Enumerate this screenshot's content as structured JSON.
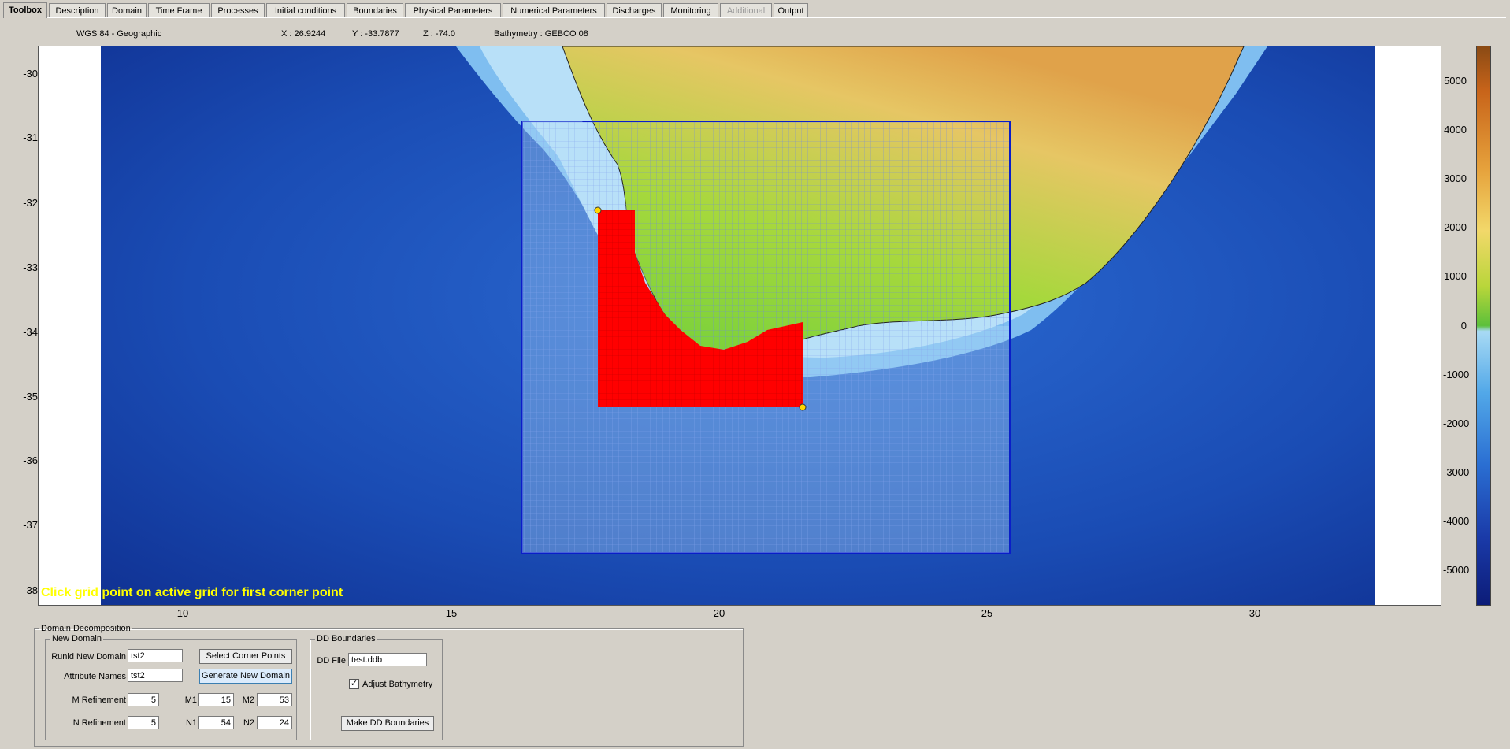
{
  "tabs": [
    {
      "label": "Toolbox",
      "state": "active"
    },
    {
      "label": "Description",
      "state": "normal"
    },
    {
      "label": "Domain",
      "state": "normal"
    },
    {
      "label": "Time Frame",
      "state": "normal"
    },
    {
      "label": "Processes",
      "state": "normal"
    },
    {
      "label": "Initial conditions",
      "state": "normal"
    },
    {
      "label": "Boundaries",
      "state": "normal"
    },
    {
      "label": "Physical Parameters",
      "state": "normal"
    },
    {
      "label": "Numerical Parameters",
      "state": "normal"
    },
    {
      "label": "Discharges",
      "state": "normal"
    },
    {
      "label": "Monitoring",
      "state": "normal"
    },
    {
      "label": "Additional",
      "state": "disabled"
    },
    {
      "label": "Output",
      "state": "normal"
    }
  ],
  "status": {
    "crs": "WGS 84 - Geographic",
    "x": "X : 26.9244",
    "y": "Y : -33.7877",
    "z": "Z : -74.0",
    "bathymetry": "Bathymetry : GEBCO 08"
  },
  "map": {
    "y_ticks": [
      "-30",
      "-31",
      "-32",
      "-33",
      "-34",
      "-35",
      "-36",
      "-37",
      "-38"
    ],
    "x_ticks": [
      "10",
      "15",
      "20",
      "25",
      "30"
    ],
    "hint": "Click grid point on active grid for first corner point",
    "colors": {
      "land": "#7fd23c",
      "ocean_deep": "#123a9c",
      "shelf": "#b8e0f8",
      "grid": "#0a1ec8",
      "refined": "#ff0000"
    }
  },
  "colorbar": {
    "labels": [
      "5000",
      "4000",
      "3000",
      "2000",
      "1000",
      "0",
      "-1000",
      "-2000",
      "-3000",
      "-4000",
      "-5000"
    ]
  },
  "domain_decomposition": {
    "title": "Domain Decomposition",
    "new_domain": {
      "title": "New Domain",
      "runid_label": "Runid New Domain",
      "runid_value": "tst2",
      "attr_label": "Attribute Names",
      "attr_value": "tst2",
      "select_corner_label": "Select Corner Points",
      "generate_label": "Generate New Domain",
      "m_ref_label": "M Refinement",
      "m_ref_value": "5",
      "n_ref_label": "N Refinement",
      "n_ref_value": "5",
      "m1_label": "M1",
      "m1_value": "15",
      "m2_label": "M2",
      "m2_value": "53",
      "n1_label": "N1",
      "n1_value": "54",
      "n2_label": "N2",
      "n2_value": "24"
    },
    "dd_boundaries": {
      "title": "DD Boundaries",
      "file_label": "DD File",
      "file_value": "test.ddb",
      "adjust_label": "Adjust Bathymetry",
      "adjust_checked": "✓",
      "make_label": "Make DD Boundaries"
    }
  }
}
